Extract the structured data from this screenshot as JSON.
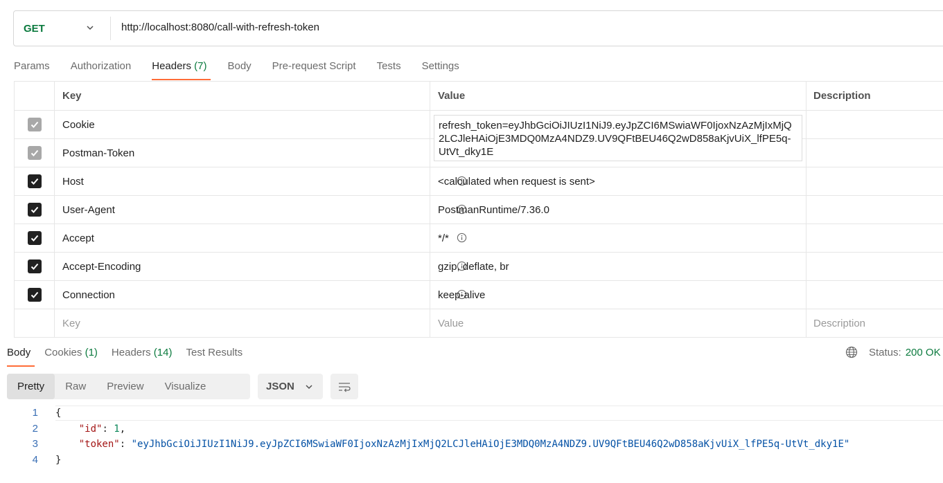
{
  "request": {
    "method": "GET",
    "url": "http://localhost:8080/call-with-refresh-token"
  },
  "request_tabs": [
    {
      "label": "Params"
    },
    {
      "label": "Authorization"
    },
    {
      "label": "Headers",
      "count": "(7)"
    },
    {
      "label": "Body"
    },
    {
      "label": "Pre-request Script"
    },
    {
      "label": "Tests"
    },
    {
      "label": "Settings"
    }
  ],
  "headers_table": {
    "columns": {
      "key": "Key",
      "value": "Value",
      "description": "Description"
    },
    "rows": [
      {
        "key": "Cookie",
        "value": "refresh_token=eyJhbGciOiJIUzI1NiJ9.eyJpZCI6MSwiaWF0IjoxNzAzMjIxMjQ2LCJleHAiOjE3MDQ0MzA4NDZ9.UV9QFtBEU46Q2wD858aKjvUiX_lfPE5q-UtVt_dky1E",
        "checked": true,
        "auto": true
      },
      {
        "key": "Postman-Token",
        "value": "",
        "checked": true,
        "auto": true
      },
      {
        "key": "Host",
        "value": "<calculated when request is sent>",
        "checked": true,
        "auto": false
      },
      {
        "key": "User-Agent",
        "value": "PostmanRuntime/7.36.0",
        "checked": true,
        "auto": false
      },
      {
        "key": "Accept",
        "value": "*/*",
        "checked": true,
        "auto": false
      },
      {
        "key": "Accept-Encoding",
        "value": "gzip, deflate, br",
        "checked": true,
        "auto": false
      },
      {
        "key": "Connection",
        "value": "keep-alive",
        "checked": true,
        "auto": false
      }
    ],
    "new_row": {
      "key_placeholder": "Key",
      "value_placeholder": "Value",
      "description_placeholder": "Description"
    }
  },
  "response_tabs": [
    {
      "label": "Body"
    },
    {
      "label": "Cookies",
      "count": "(1)"
    },
    {
      "label": "Headers",
      "count": "(14)"
    },
    {
      "label": "Test Results"
    }
  ],
  "status": {
    "label": "Status:",
    "value": "200 OK"
  },
  "view_modes": [
    "Pretty",
    "Raw",
    "Preview",
    "Visualize"
  ],
  "format": "JSON",
  "code_lines": [
    {
      "n": "1",
      "text": "{"
    },
    {
      "n": "2",
      "key": "\"id\"",
      "value": "1"
    },
    {
      "n": "3",
      "key": "\"token\"",
      "value": "\"eyJhbGciOiJIUzI1NiJ9.eyJpZCI6MSwiaWF0IjoxNzAzMjIxMjQ2LCJleHAiOjE3MDQ0MzA4NDZ9.UV9QFtBEU46Q2wD858aKjvUiX_lfPE5q-UtVt_dky1E\""
    },
    {
      "n": "4",
      "text": "}"
    }
  ],
  "colors": {
    "accent": "#ff6c37",
    "method_get": "#0b7a3e",
    "status_ok": "#0b7a3e"
  }
}
